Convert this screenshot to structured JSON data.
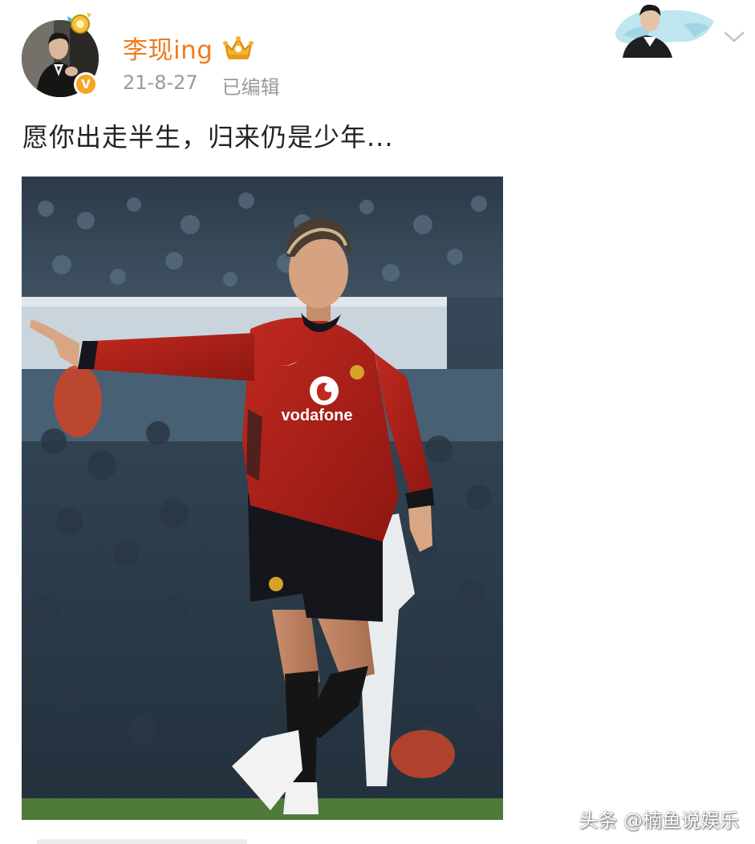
{
  "post": {
    "username": "李现ing",
    "date": "21-8-27",
    "edited_label": "已编辑",
    "text": "愿你出走半生，归来仍是少年...",
    "vip_badge_text": "V"
  },
  "photo": {
    "sponsor_text": "vodafone"
  },
  "watermark": {
    "text": "头条 @楠鱼说娱乐"
  },
  "icons": {
    "avatar_decoration": "gold-ornament-icon",
    "crown": "crown-icon",
    "verified": "vip-badge-icon",
    "menu": "chevron-down-icon"
  },
  "colors": {
    "username": "#f07b1d",
    "meta": "#9a9a9a",
    "text": "#222222",
    "badge": "#f5a623",
    "jersey": "#b8241e"
  }
}
